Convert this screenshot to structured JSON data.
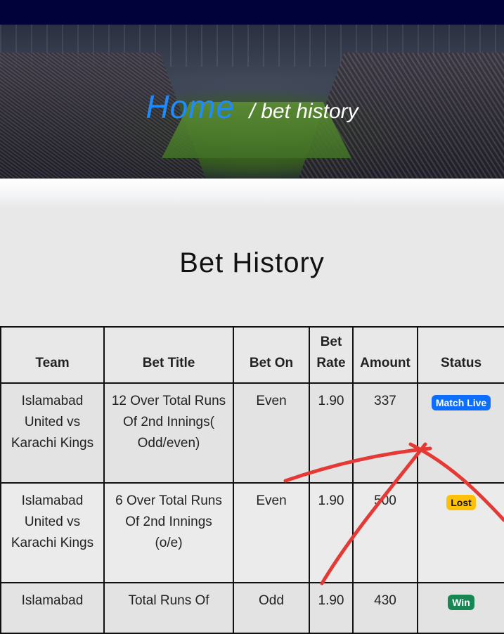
{
  "header": {
    "background_color": "#02023a"
  },
  "hero": {
    "breadcrumb": {
      "home_label": "Home",
      "current_label": "/ bet history"
    }
  },
  "page": {
    "title": "Bet History"
  },
  "table": {
    "headers": {
      "team": "Team",
      "bet_title": "Bet Title",
      "bet_on": "Bet On",
      "bet_rate": "Bet Rate",
      "amount": "Amount",
      "status": "Status"
    },
    "rows": [
      {
        "team": "Islamabad United vs Karachi Kings",
        "bet_title": "12 Over Total Runs Of 2nd Innings( Odd/even)",
        "bet_on": "Even",
        "bet_rate": "1.90",
        "amount": "337",
        "status": "Match Live",
        "status_color": "#0d6efd"
      },
      {
        "team": "Islamabad United vs Karachi Kings",
        "bet_title": "6 Over Total Runs Of 2nd Innings (o/e)",
        "bet_on": "Even",
        "bet_rate": "1.90",
        "amount": "500",
        "status": "Lost",
        "status_color": "#ffc107"
      },
      {
        "team": "Islamabad",
        "bet_title": "Total Runs Of",
        "bet_on": "Odd",
        "bet_rate": "1.90",
        "amount": "430",
        "status": "Win",
        "status_color": "#198754"
      }
    ]
  },
  "annotation_color": "#e53935"
}
